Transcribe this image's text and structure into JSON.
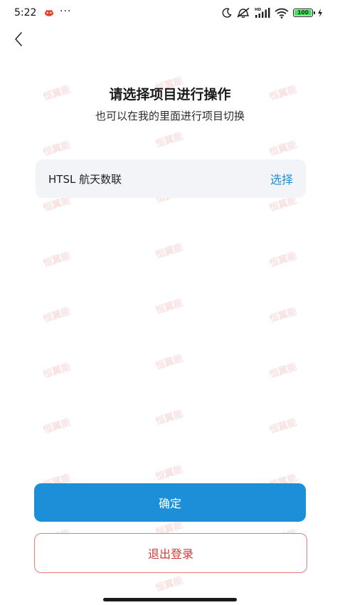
{
  "status_bar": {
    "time": "5:22",
    "more": "···",
    "battery_level": "100",
    "battery_percent": 100
  },
  "icons": [
    "back-arrow-icon",
    "app-notification-icon",
    "moon-icon",
    "mute-icon",
    "hd-signal-icon",
    "wifi-icon",
    "battery-icon",
    "charging-icon"
  ],
  "colors": {
    "primary": "#1c8fd8",
    "link": "#1e8fd6",
    "danger": "#d23a3a",
    "danger_border": "#e37d7d",
    "card_bg": "#f2f4f7",
    "watermark": "#dc4646"
  },
  "header": {
    "title": "请选择项目进行操作",
    "subtitle": "也可以在我的里面进行项目切换"
  },
  "project": {
    "name": "HTSL 航天数联",
    "select_label": "选择"
  },
  "actions": {
    "confirm_label": "确定",
    "logout_label": "退出登录"
  },
  "watermark": {
    "text": "恒翼能"
  }
}
